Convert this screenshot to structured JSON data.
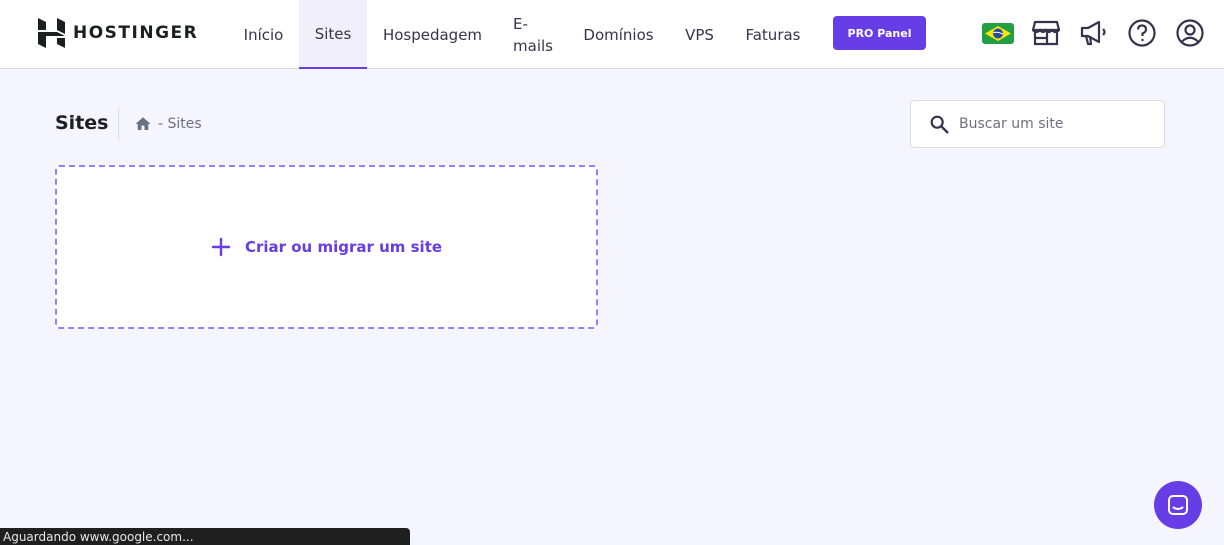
{
  "brand": {
    "name": "HOSTINGER"
  },
  "nav": {
    "items": [
      {
        "label": "Início"
      },
      {
        "label": "Sites",
        "active": true
      },
      {
        "label": "Hospedagem"
      },
      {
        "label": "E-\nmails"
      },
      {
        "label": "Domínios"
      },
      {
        "label": "VPS"
      },
      {
        "label": "Faturas"
      }
    ],
    "pro_button": "PRO Panel"
  },
  "header_icons": [
    "brazil-flag-icon",
    "store-icon",
    "megaphone-icon",
    "help-icon",
    "account-icon"
  ],
  "page": {
    "title": "Sites",
    "breadcrumb": "- Sites"
  },
  "search": {
    "placeholder": "Buscar um site"
  },
  "create_card": {
    "label": "Criar ou migrar um site"
  },
  "status_bar": {
    "text": "Aguardando www.google.com..."
  },
  "colors": {
    "accent": "#673de6",
    "background": "#f4f5ff",
    "dashed_border": "#8c85ff"
  }
}
